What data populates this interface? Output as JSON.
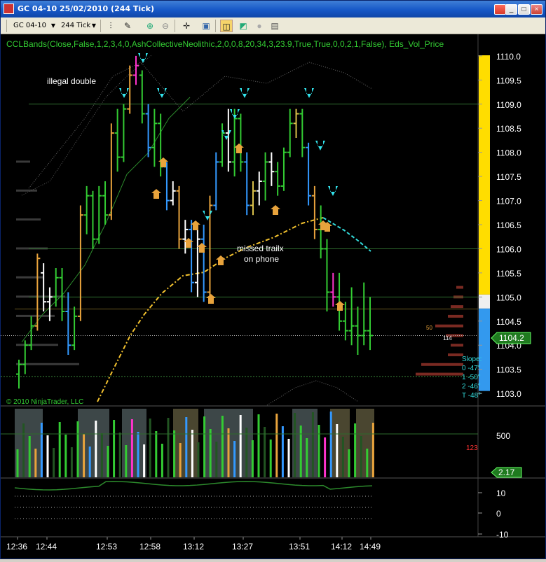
{
  "window": {
    "title": "GC 04-10  25/02/2010 (244 Tick)",
    "buttons": [
      "_",
      "□",
      "×"
    ]
  },
  "toolbar": {
    "instrument": "GC 04-10",
    "period": "244 Tick"
  },
  "chart": {
    "indicator_label": "CCLBands(Close,False,1,2,3,4,0,AshCollectiveNeolithic,2,0,0,8,20,34,3,23.9,True,True,0,0,2,1,False), Eds_Vol_Price",
    "copyright": "© 2010 NinjaTrader, LLC",
    "annotations": [
      "illegal double",
      "missed trailx",
      "on phone"
    ],
    "current_price": "1104.2",
    "slope_text": [
      "Slope:",
      "0  -47°",
      "1  -50°",
      "2  -46°",
      "T  -48°"
    ],
    "small_labels": [
      "50",
      "114"
    ],
    "volume_current": "2.17",
    "volume_small": "123",
    "colors": {
      "up": "#33cc33",
      "down": "#3399ff",
      "highlight": "#ff33cc",
      "neutral": "#ffffff",
      "orange": "#e8a33c",
      "yellow_bar": "#ffdd00"
    }
  },
  "chart_data": {
    "type": "line",
    "title": "",
    "price_axis": [
      "1110.0",
      "1109.5",
      "1109.0",
      "1108.5",
      "1108.0",
      "1107.5",
      "1107.0",
      "1106.5",
      "1106.0",
      "1105.5",
      "1105.0",
      "1104.5",
      "1104.0",
      "1103.5",
      "1103.0"
    ],
    "volume_axis": [
      "500"
    ],
    "oscillator_axis": [
      "10",
      "0",
      "-10"
    ],
    "time_labels": [
      "12:36",
      "12:44",
      "12:53",
      "12:58",
      "13:12",
      "13:27",
      "13:51",
      "14:12",
      "14:49"
    ],
    "ylim": [
      1102.9,
      1110.1
    ],
    "bars": [
      {
        "o": 1103.4,
        "h": 1103.7,
        "l": 1103.1,
        "c": 1103.6,
        "col": "g"
      },
      {
        "o": 1103.6,
        "h": 1104.1,
        "l": 1103.4,
        "c": 1104.0,
        "col": "g"
      },
      {
        "o": 1104.0,
        "h": 1104.6,
        "l": 1103.9,
        "c": 1104.4,
        "col": "g"
      },
      {
        "o": 1104.4,
        "h": 1105.9,
        "l": 1104.3,
        "c": 1105.8,
        "col": "o"
      },
      {
        "o": 1105.5,
        "h": 1105.7,
        "l": 1104.7,
        "c": 1104.9,
        "col": "w"
      },
      {
        "o": 1104.9,
        "h": 1105.2,
        "l": 1104.5,
        "c": 1105.0,
        "col": "w"
      },
      {
        "o": 1105.0,
        "h": 1105.6,
        "l": 1104.8,
        "c": 1105.4,
        "col": "g"
      },
      {
        "o": 1105.4,
        "h": 1105.6,
        "l": 1104.5,
        "c": 1104.7,
        "col": "g"
      },
      {
        "o": 1104.7,
        "h": 1105.1,
        "l": 1103.8,
        "c": 1104.0,
        "col": "b"
      },
      {
        "o": 1104.0,
        "h": 1104.8,
        "l": 1103.9,
        "c": 1104.6,
        "col": "g"
      },
      {
        "o": 1104.6,
        "h": 1106.9,
        "l": 1104.5,
        "c": 1106.7,
        "col": "o"
      },
      {
        "o": 1106.7,
        "h": 1107.3,
        "l": 1106.3,
        "c": 1107.1,
        "col": "g"
      },
      {
        "o": 1107.1,
        "h": 1107.2,
        "l": 1106.0,
        "c": 1106.2,
        "col": "g"
      },
      {
        "o": 1106.2,
        "h": 1107.3,
        "l": 1106.1,
        "c": 1107.1,
        "col": "g"
      },
      {
        "o": 1107.1,
        "h": 1107.4,
        "l": 1106.5,
        "c": 1106.7,
        "col": "g"
      },
      {
        "o": 1106.7,
        "h": 1108.6,
        "l": 1106.6,
        "c": 1108.4,
        "col": "o"
      },
      {
        "o": 1108.4,
        "h": 1108.9,
        "l": 1107.6,
        "c": 1107.9,
        "col": "g"
      },
      {
        "o": 1107.9,
        "h": 1109.0,
        "l": 1107.8,
        "c": 1108.9,
        "col": "g"
      },
      {
        "o": 1108.9,
        "h": 1109.8,
        "l": 1108.8,
        "c": 1109.6,
        "col": "o"
      },
      {
        "o": 1109.6,
        "h": 1110.0,
        "l": 1109.4,
        "c": 1109.8,
        "col": "m"
      },
      {
        "o": 1109.6,
        "h": 1109.7,
        "l": 1108.6,
        "c": 1108.8,
        "col": "g"
      },
      {
        "o": 1108.8,
        "h": 1109.0,
        "l": 1107.9,
        "c": 1108.1,
        "col": "b"
      },
      {
        "o": 1108.1,
        "h": 1108.9,
        "l": 1107.7,
        "c": 1108.6,
        "col": "g"
      },
      {
        "o": 1108.6,
        "h": 1108.8,
        "l": 1107.5,
        "c": 1107.7,
        "col": "g"
      },
      {
        "o": 1107.7,
        "h": 1107.8,
        "l": 1106.8,
        "c": 1107.0,
        "col": "b"
      },
      {
        "o": 1107.0,
        "h": 1107.4,
        "l": 1106.9,
        "c": 1107.2,
        "col": "w"
      },
      {
        "o": 1107.2,
        "h": 1107.3,
        "l": 1106.0,
        "c": 1106.2,
        "col": "o"
      },
      {
        "o": 1106.2,
        "h": 1106.6,
        "l": 1105.9,
        "c": 1106.4,
        "col": "w"
      },
      {
        "o": 1106.4,
        "h": 1106.6,
        "l": 1105.1,
        "c": 1105.3,
        "col": "b"
      },
      {
        "o": 1105.3,
        "h": 1106.4,
        "l": 1105.0,
        "c": 1106.2,
        "col": "w"
      },
      {
        "o": 1106.2,
        "h": 1106.5,
        "l": 1104.9,
        "c": 1105.1,
        "col": "b"
      },
      {
        "o": 1105.1,
        "h": 1107.1,
        "l": 1105.0,
        "c": 1106.9,
        "col": "o"
      },
      {
        "o": 1106.9,
        "h": 1108.0,
        "l": 1106.8,
        "c": 1107.8,
        "col": "b"
      },
      {
        "o": 1107.8,
        "h": 1108.6,
        "l": 1107.7,
        "c": 1108.4,
        "col": "g"
      },
      {
        "o": 1108.4,
        "h": 1108.9,
        "l": 1107.6,
        "c": 1107.8,
        "col": "w"
      },
      {
        "o": 1107.8,
        "h": 1108.9,
        "l": 1107.5,
        "c": 1108.7,
        "col": "g"
      },
      {
        "o": 1108.7,
        "h": 1108.8,
        "l": 1107.6,
        "c": 1107.8,
        "col": "g"
      },
      {
        "o": 1107.8,
        "h": 1108.0,
        "l": 1106.7,
        "c": 1106.9,
        "col": "b"
      },
      {
        "o": 1106.9,
        "h": 1107.4,
        "l": 1106.7,
        "c": 1107.2,
        "col": "y"
      },
      {
        "o": 1107.2,
        "h": 1107.6,
        "l": 1106.9,
        "c": 1107.4,
        "col": "w"
      },
      {
        "o": 1107.4,
        "h": 1108.0,
        "l": 1107.0,
        "c": 1107.8,
        "col": "g"
      },
      {
        "o": 1107.8,
        "h": 1108.0,
        "l": 1107.3,
        "c": 1107.6,
        "col": "w"
      },
      {
        "o": 1107.6,
        "h": 1107.8,
        "l": 1107.1,
        "c": 1107.3,
        "col": "g"
      },
      {
        "o": 1107.3,
        "h": 1108.1,
        "l": 1107.2,
        "c": 1108.0,
        "col": "g"
      },
      {
        "o": 1108.0,
        "h": 1108.9,
        "l": 1107.9,
        "c": 1108.6,
        "col": "g"
      },
      {
        "o": 1108.6,
        "h": 1108.9,
        "l": 1108.3,
        "c": 1108.8,
        "col": "y"
      },
      {
        "o": 1108.8,
        "h": 1108.9,
        "l": 1107.9,
        "c": 1108.1,
        "col": "g"
      },
      {
        "o": 1108.1,
        "h": 1108.2,
        "l": 1106.9,
        "c": 1107.1,
        "col": "b"
      },
      {
        "o": 1107.1,
        "h": 1107.3,
        "l": 1106.2,
        "c": 1106.4,
        "col": "o"
      },
      {
        "o": 1106.4,
        "h": 1106.9,
        "l": 1105.8,
        "c": 1106.0,
        "col": "g"
      },
      {
        "o": 1106.0,
        "h": 1106.2,
        "l": 1104.7,
        "c": 1105.1,
        "col": "g"
      },
      {
        "o": 1105.1,
        "h": 1105.5,
        "l": 1104.8,
        "c": 1105.0,
        "col": "m"
      },
      {
        "o": 1105.0,
        "h": 1105.5,
        "l": 1104.3,
        "c": 1104.5,
        "col": "g"
      },
      {
        "o": 1104.5,
        "h": 1104.9,
        "l": 1104.1,
        "c": 1104.3,
        "col": "g"
      },
      {
        "o": 1104.3,
        "h": 1105.2,
        "l": 1104.0,
        "c": 1104.4,
        "col": "g"
      },
      {
        "o": 1104.4,
        "h": 1104.8,
        "l": 1103.8,
        "c": 1104.2,
        "col": "g"
      },
      {
        "o": 1104.2,
        "h": 1105.3,
        "l": 1104.0,
        "c": 1104.3,
        "col": "g"
      },
      {
        "o": 1104.3,
        "h": 1105.0,
        "l": 1103.9,
        "c": 1104.2,
        "col": "g"
      }
    ]
  }
}
